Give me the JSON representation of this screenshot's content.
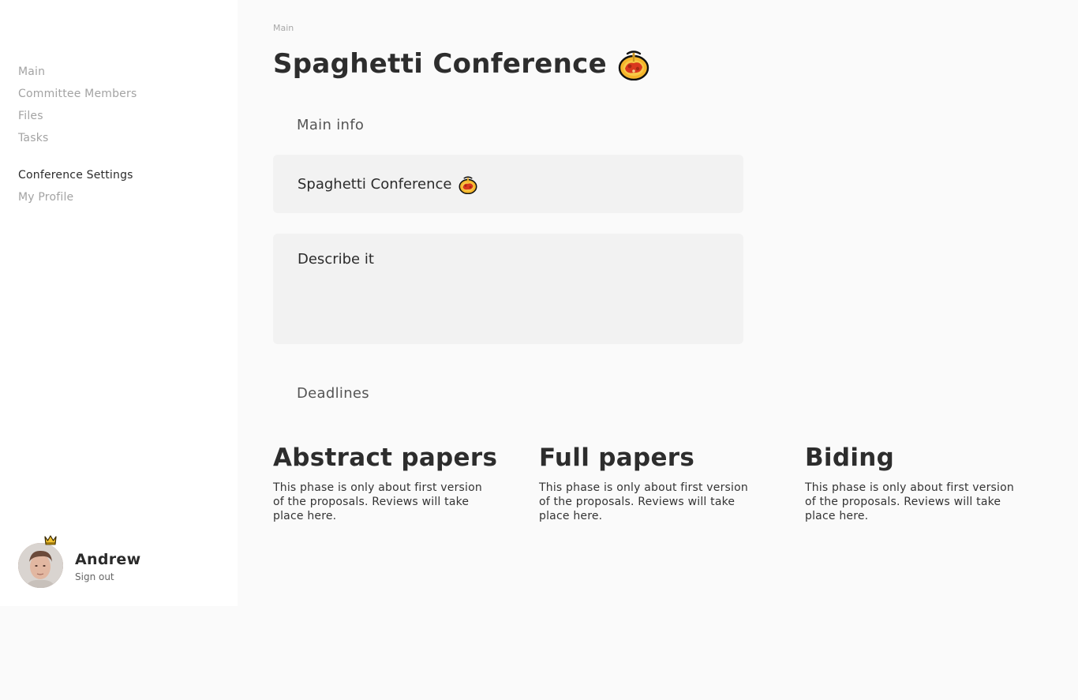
{
  "sidebar": {
    "nav_primary": [
      "Main",
      "Committee Members",
      "Files",
      "Tasks"
    ],
    "nav_secondary": [
      "Conference Settings",
      "My Profile"
    ],
    "active_item": "Conference Settings"
  },
  "user": {
    "name": "Andrew",
    "signout_label": "Sign out"
  },
  "main": {
    "breadcrumb": "Main",
    "title": "Spaghetti Conference",
    "main_info_label": "Main info",
    "conference_name": "Spaghetti Conference",
    "description_placeholder": "Describe it",
    "deadlines_label": "Deadlines",
    "phases": [
      {
        "title": "Abstract papers",
        "description": "This phase is only about first version of the proposals. Reviews will take place here."
      },
      {
        "title": "Full papers",
        "description": "This phase is only about first version of the proposals. Reviews will take place here."
      },
      {
        "title": "Biding",
        "description": "This phase is only about first version of the proposals. Reviews will take place here."
      }
    ]
  },
  "icons": {
    "title_emoji": "spaghetti-icon",
    "crown": "crown-icon"
  },
  "colors": {
    "sidebar_bg": "#ffffff",
    "page_bg": "#fafafa",
    "field_bg": "#f2f2f2",
    "nav_inactive": "#a3a3a3",
    "text_dark": "#2b2b2b"
  }
}
